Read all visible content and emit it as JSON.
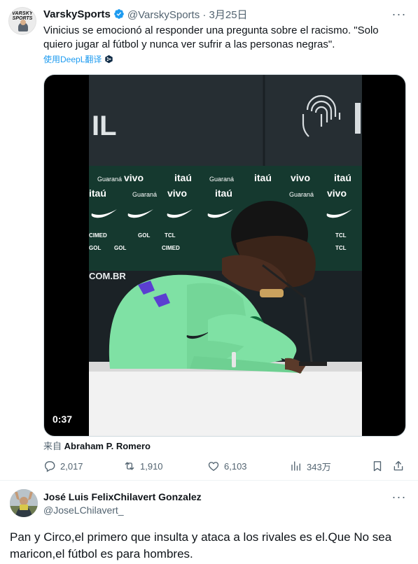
{
  "tweet": {
    "avatar_text_top": "VARSKY",
    "avatar_text_bottom": "SPORTS",
    "display_name": "VarskySports",
    "handle_date": "@VarskySports · 3月25日",
    "text": "Vinicius se emocionó al responder una pregunta sobre el racismo. \"Solo quiero jugar al fútbol y nunca ver sufrir a las personas negras\".",
    "translate_label": "使用DeepL翻译",
    "more_label": "···",
    "video": {
      "duration": "0:37",
      "backdrop_sponsors": [
        "Guaraná",
        "vivo",
        "itaú",
        "Guaraná",
        "vivo",
        "itaú"
      ],
      "backdrop_tags": [
        "TCL",
        "GOL",
        "CIMED"
      ],
      "backdrop_site": "COM.BR",
      "backdrop_partial": "IL"
    },
    "attribution_prefix": "来自",
    "attribution_name": "Abraham P. Romero",
    "stats": {
      "replies": "2,017",
      "retweets": "1,910",
      "likes": "6,103",
      "views": "343万"
    }
  },
  "reply": {
    "display_name": "José Luis FelixChilavert Gonzalez",
    "handle": "@JoseLChilavert_",
    "more_label": "···",
    "text": "Pan y Circo,el primero que insulta y ataca a los rivales es el.Que No sea maricon,el fútbol es para hombres."
  },
  "colors": {
    "text": "#0f1419",
    "secondary": "#536471",
    "accent": "#1d9bf0",
    "shirt": "#7fe1a4"
  },
  "icons": [
    "verified-badge-icon",
    "more-icon",
    "deepl-icon",
    "reply-icon",
    "retweet-icon",
    "like-icon",
    "views-icon",
    "bookmark-icon",
    "share-icon"
  ]
}
